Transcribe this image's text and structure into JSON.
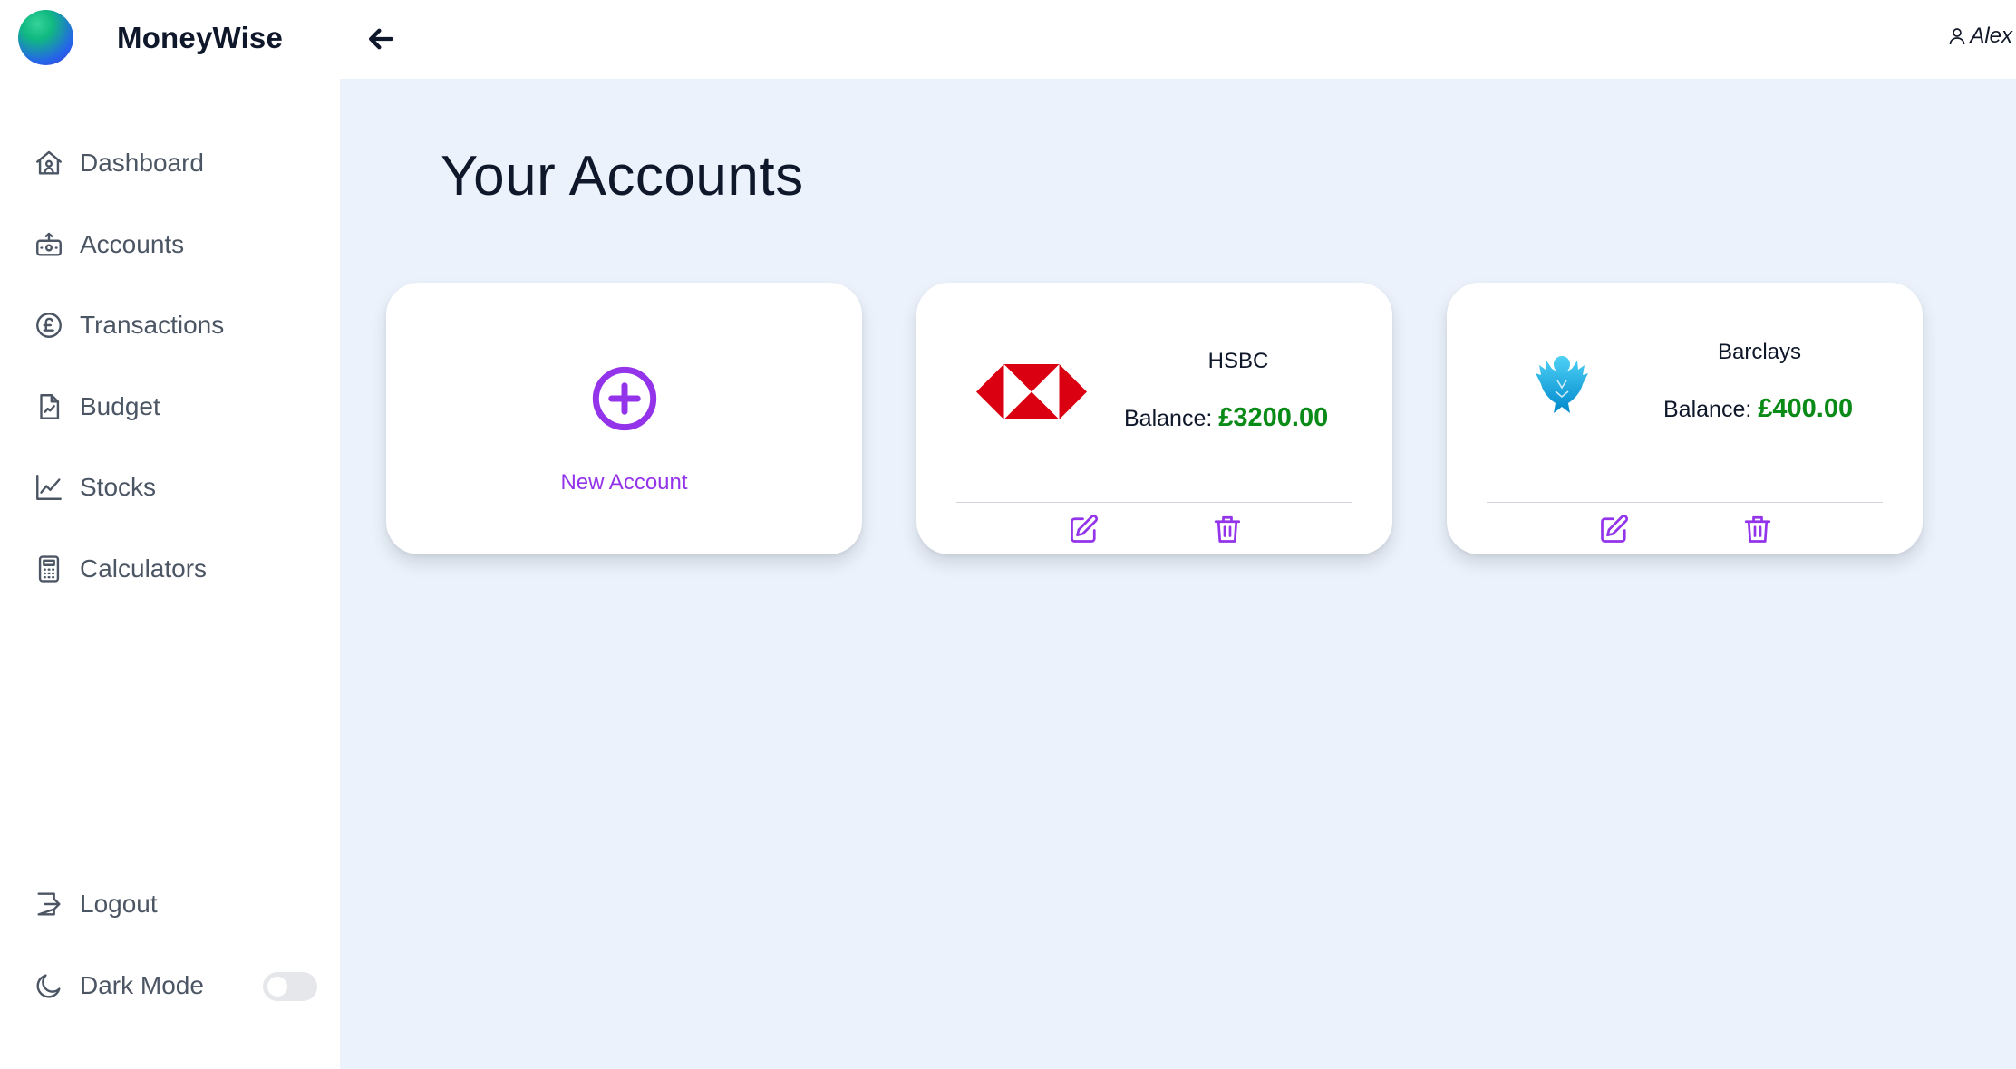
{
  "app": {
    "name": "MoneyWise"
  },
  "sidebar": {
    "items": [
      {
        "label": "Dashboard",
        "icon": "home-icon"
      },
      {
        "label": "Accounts",
        "icon": "bank-account-icon"
      },
      {
        "label": "Transactions",
        "icon": "pound-coin-icon"
      },
      {
        "label": "Budget",
        "icon": "document-chart-icon"
      },
      {
        "label": "Stocks",
        "icon": "line-chart-icon"
      },
      {
        "label": "Calculators",
        "icon": "calculator-icon"
      }
    ],
    "logout_label": "Logout",
    "dark_mode_label": "Dark Mode",
    "dark_mode_enabled": false
  },
  "topbar": {
    "user_name": "Alex"
  },
  "main": {
    "title": "Your Accounts",
    "new_account_label": "New Account",
    "balance_label": "Balance:",
    "accounts": [
      {
        "name": "HSBC",
        "balance": "£3200.00",
        "logo": "hsbc-logo"
      },
      {
        "name": "Barclays",
        "balance": "£400.00",
        "logo": "barclays-eagle-logo"
      }
    ]
  },
  "colors": {
    "accent": "#9333ea",
    "balance_positive": "#0a8a17",
    "main_background": "#ebf2fb",
    "hsbc_red": "#db0011",
    "barclays_blue": "#00aeef"
  }
}
